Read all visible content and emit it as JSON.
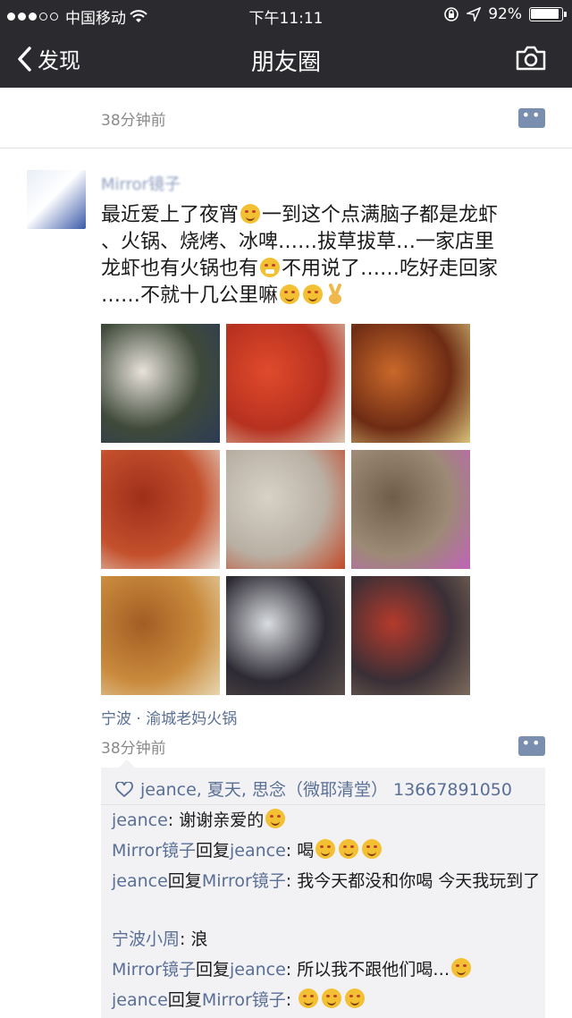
{
  "status_bar": {
    "carrier": "中国移动",
    "time": "下午11:11",
    "battery": "92%"
  },
  "nav": {
    "back_label": "发现",
    "title": "朋友圈"
  },
  "stub_post": {
    "timestamp": "38分钟前"
  },
  "post": {
    "author": "Mirror镜子",
    "lines": [
      [
        "最近爱上了夜宵",
        "smile",
        "一到这个点满脑子都是龙虾"
      ],
      [
        "、火锅、烧烤、冰啤……拔草拔草…一家店里"
      ],
      [
        "龙虾也有火锅也有",
        "grin",
        "不用说了……吃好走回家"
      ],
      [
        "……不就十几公里嘛",
        "smile",
        "smile",
        "victory"
      ]
    ],
    "location": "宁波 · 渝城老妈火锅",
    "timestamp": "38分钟前",
    "photos": [
      {
        "name": "chefs"
      },
      {
        "name": "lobster"
      },
      {
        "name": "crayfish-dish"
      },
      {
        "name": "spicy-crayfish"
      },
      {
        "name": "hotpot"
      },
      {
        "name": "tofu-plate"
      },
      {
        "name": "fried-crayfish"
      },
      {
        "name": "dining-hall"
      },
      {
        "name": "storefront"
      }
    ]
  },
  "likes": "jeance, 夏天, 思念（微耶清堂） 13667891050",
  "comments": [
    {
      "segments": [
        [
          "jeance",
          true
        ],
        [
          ": 谢谢亲爱的",
          false
        ]
      ],
      "emoji": 1,
      "lines": 1
    },
    {
      "segments": [
        [
          "Mirror镜子",
          true
        ],
        [
          "回复",
          false
        ],
        [
          "jeance",
          true
        ],
        [
          ": 喝",
          false
        ]
      ],
      "emoji": 3,
      "lines": 1
    },
    {
      "segments": [
        [
          "jeance",
          true
        ],
        [
          "回复",
          false
        ],
        [
          "Mirror镜子",
          true
        ],
        [
          ": 我今天都没和你喝",
          false
        ],
        [
          " 今天我玩到了",
          false
        ]
      ],
      "emoji": 0,
      "lines": 2
    },
    {
      "segments": [
        [
          "宁波小周",
          true
        ],
        [
          ": 浪",
          false
        ]
      ],
      "emoji": 0,
      "lines": 1
    },
    {
      "segments": [
        [
          "Mirror镜子",
          true
        ],
        [
          "回复",
          false
        ],
        [
          "jeance",
          true
        ],
        [
          ": 所以我不跟他们喝…",
          false
        ]
      ],
      "emoji": 1,
      "lines": 1
    },
    {
      "segments": [
        [
          "jeance",
          true
        ],
        [
          "回复",
          false
        ],
        [
          "Mirror镜子",
          true
        ],
        [
          ": ",
          false
        ]
      ],
      "emoji": 3,
      "lines": 1
    }
  ]
}
